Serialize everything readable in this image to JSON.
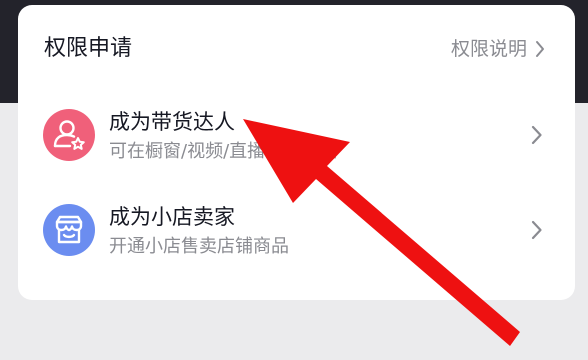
{
  "dialog": {
    "title": "权限申请",
    "header_link": "权限说明",
    "items": [
      {
        "title": "成为带货达人",
        "subtitle": "可在橱窗/视频/直播推广商品",
        "icon": "user-star-icon",
        "icon_color": "#f0607a"
      },
      {
        "title": "成为小店卖家",
        "subtitle": "开通小店售卖店铺商品",
        "icon": "shop-icon",
        "icon_color": "#6b8df0"
      }
    ]
  },
  "annotation": {
    "arrow_color": "#ee1111"
  }
}
